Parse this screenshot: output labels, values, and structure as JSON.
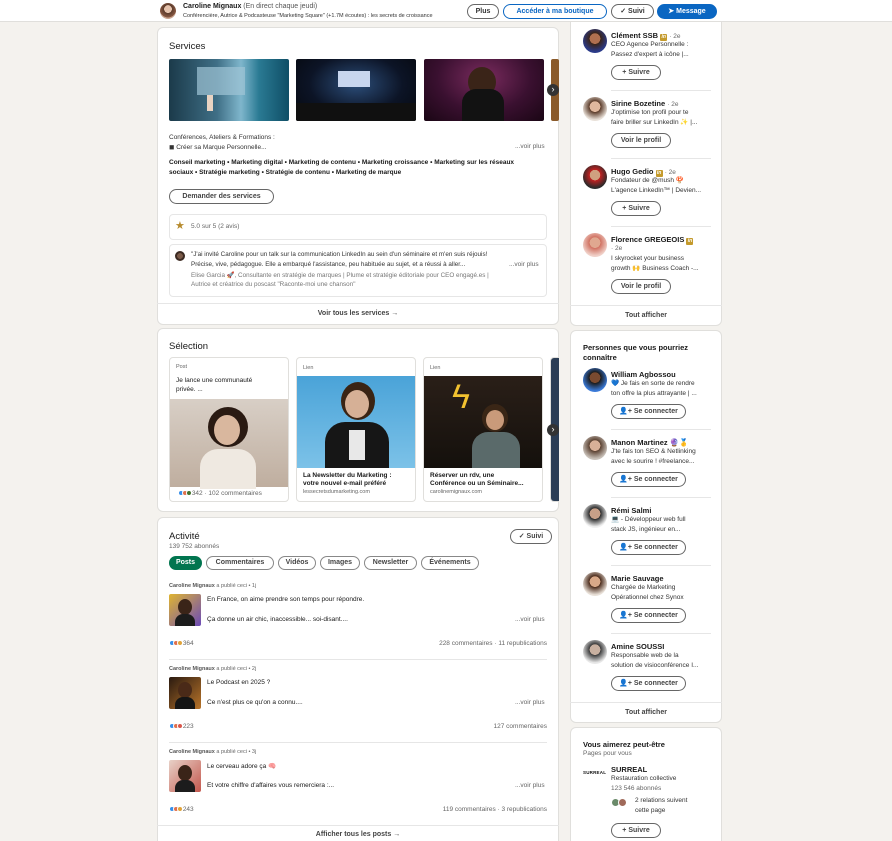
{
  "topbar": {
    "name": "Caroline Mignaux",
    "status": "(En direct chaque jeudi)",
    "headline": "Conférencière, Autrice & Podcasteuse \"Marketing Square\" (+1.7M écoutes) : les secrets de croissance",
    "buttons": {
      "plus": "Plus",
      "shop": "Accéder à ma boutique",
      "follow": "✓ Suivi",
      "message": "Message"
    }
  },
  "services": {
    "title": "Services",
    "desc_line1": "Conférences, Ateliers & Formations :",
    "desc_line2": "◼ Créer sa Marque Personnelle...",
    "see_more": "...voir plus",
    "skills_line1": "Conseil marketing • Marketing digital • Marketing de contenu • Marketing croissance • Marketing sur les réseaux",
    "skills_line2": "sociaux • Stratégie marketing • Stratégie de contenu • Marketing de marque",
    "request_button": "Demander des services",
    "rating": "5.0 sur 5 (2 avis)",
    "review_line1": "\"J'ai invité Caroline pour un talk sur la communication LinkedIn au sein d'un séminaire et m'en suis réjouis!",
    "review_line2": "Précise, vive, pédagogue. Elle a embarqué l'assistance, peu habituée au sujet, et a réussi à aller...",
    "review_more": "...voir plus",
    "review_author_line1": "Elise Garcia 🚀, Consultante en stratégie de marques | Plume et stratégie éditoriale pour CEO engagé.es |",
    "review_author_line2": "Autrice et créatrice du poscast \"Raconte-moi une chanson\"",
    "footer": "Voir tous les services →"
  },
  "selection": {
    "title": "Sélection",
    "cards": [
      {
        "tag": "Post",
        "text_line1": "Je lance une communauté",
        "text_line2": "privée. ...",
        "reactions": "342 · 102 commentaires"
      },
      {
        "tag": "Lien",
        "title_line1": "La Newsletter du Marketing :",
        "title_line2": "votre nouvel e-mail préféré",
        "site": "lessecretsdumarketing.com"
      },
      {
        "tag": "Lien",
        "title_line1": "Réserver un rdv, une",
        "title_line2": "Conférence ou un Séminaire...",
        "site": "carolinemignaux.com"
      }
    ]
  },
  "activity": {
    "title": "Activité",
    "followers": "139 752 abonnés",
    "follow_button": "✓ Suivi",
    "tabs": [
      "Posts",
      "Commentaires",
      "Vidéos",
      "Images",
      "Newsletter",
      "Événements"
    ],
    "posts": [
      {
        "author": "Caroline Mignaux",
        "meta": " a publié ceci • 1j",
        "line1": "En France, on aime prendre son temps pour répondre.",
        "line2": "Ça donne un air chic, inaccessible... soi-disant....",
        "more": "...voir plus",
        "reactions": "364",
        "stats": "228 commentaires · 11 republications"
      },
      {
        "author": "Caroline Mignaux",
        "meta": " a publié ceci • 2j",
        "line1": "Le Podcast en 2025 ?",
        "line2": "Ce n'est plus ce qu'on a connu....",
        "more": "...voir plus",
        "reactions": "223",
        "stats": "127 commentaires"
      },
      {
        "author": "Caroline Mignaux",
        "meta": " a publié ceci • 3j",
        "line1": "Le cerveau adore ça 🧠",
        "line2": "Et votre chiffre d'affaires vous remerciera :...",
        "more": "...voir plus",
        "reactions": "243",
        "stats": "119 commentaires · 3 republications"
      }
    ],
    "footer": "Afficher tous les posts →"
  },
  "right_top": {
    "people": [
      {
        "name": "Clément SSB",
        "deg": "· 2e",
        "desc1": "CEO Agence Personnelle :",
        "desc2": "Passez d'expert à icône |...",
        "button": "+ Suivre"
      },
      {
        "name": "Sirine Bozetine",
        "deg": "· 2e",
        "desc1": "J'optimise ton profil pour te",
        "desc2": "faire briller sur LinkedIn ✨ |...",
        "button": "Voir le profil"
      },
      {
        "name": "Hugo Gedio",
        "deg": "· 2e",
        "desc1": "Fondateur de @mush 🍄",
        "desc2": "L'agence LinkedIn™ | Devien...",
        "button": "+ Suivre"
      },
      {
        "name": "Florence GREGEOIS",
        "deg": "· 2e",
        "desc1": "I skyrocket your business",
        "desc2": "growth 🙌 Business Coach -...",
        "button": "Voir le profil"
      }
    ],
    "footer": "Tout afficher"
  },
  "suggestions": {
    "title_line1": "Personnes que vous pourriez",
    "title_line2": "connaître",
    "people": [
      {
        "name": "William Agbossou",
        "desc1": "💙 Je fais en sorte de rendre",
        "desc2": "ton offre la plus attrayante | ...",
        "button": "Se connecter"
      },
      {
        "name": "Manon Martinez 🔮🥇",
        "desc1": "J'te fais ton SEO & Netlinking",
        "desc2": "avec le sourire ! #freelance...",
        "button": "Se connecter"
      },
      {
        "name": "Rémi Salmi",
        "desc1": "💻 - Développeur web full",
        "desc2": "stack JS, ingénieur en...",
        "button": "Se connecter"
      },
      {
        "name": "Marie Sauvage",
        "desc1": "Chargée de Marketing",
        "desc2": "Opérationnel chez Synox",
        "button": "Se connecter"
      },
      {
        "name": "Amine SOUSSI",
        "desc1": "Responsable web de la",
        "desc2": "solution de visioconférence I...",
        "button": "Se connecter"
      }
    ],
    "footer": "Tout afficher"
  },
  "pages": {
    "title": "Vous aimerez peut-être",
    "subtitle": "Pages pour vous",
    "logo_text": "SURREAL",
    "name": "SURREAL",
    "category": "Restauration collective",
    "followers": "123 546 abonnés",
    "relations_line1": "2 relations suivent",
    "relations_line2": "cette page",
    "button": "+ Suivre"
  }
}
